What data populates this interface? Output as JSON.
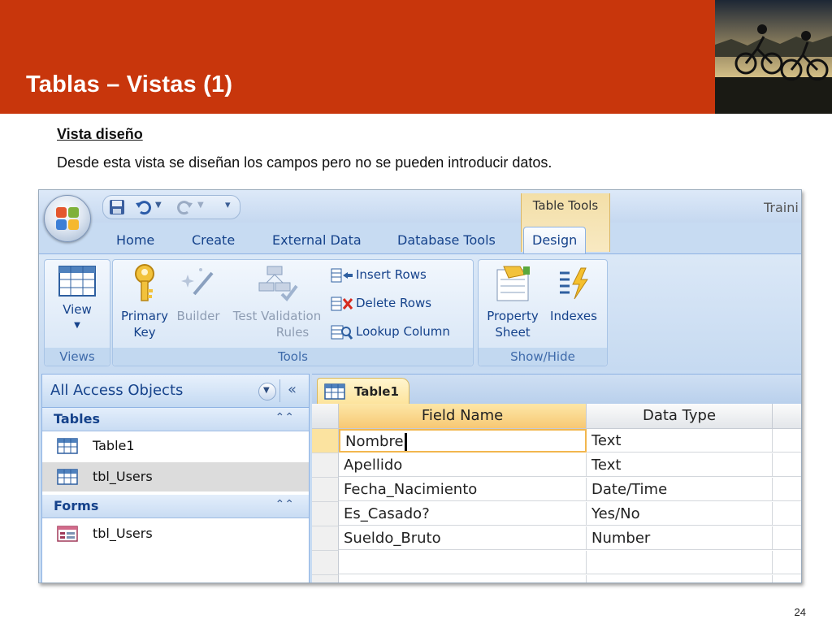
{
  "slide": {
    "title": "Tablas – Vistas (1)",
    "subtitle": "Vista diseño",
    "description": "Desde esta vista se diseñan los campos pero no se pueden introducir datos.",
    "page_number": "24",
    "accent_color": "#c8360c"
  },
  "app": {
    "title_partial": "Traini",
    "context_tab_label": "Table Tools",
    "tabs": [
      "Home",
      "Create",
      "External Data",
      "Database Tools",
      "Design"
    ],
    "active_tab": "Design"
  },
  "ribbon": {
    "views": {
      "view_label": "View",
      "group_label": "Views"
    },
    "tools": {
      "primary_key_label": "Primary Key",
      "primary_key_line1": "Primary",
      "primary_key_line2": "Key",
      "builder_label": "Builder",
      "test_label": "Test",
      "validation_rules_line1": "Validation",
      "validation_rules_line2": "Rules",
      "insert_rows_label": "Insert Rows",
      "delete_rows_label": "Delete Rows",
      "lookup_column_label": "Lookup Column",
      "group_label": "Tools"
    },
    "show_hide": {
      "property_sheet_line1": "Property",
      "property_sheet_line2": "Sheet",
      "indexes_label": "Indexes",
      "group_label": "Show/Hide"
    }
  },
  "nav_pane": {
    "title": "All Access Objects",
    "categories": [
      {
        "label": "Tables",
        "items": [
          "Table1",
          "tbl_Users"
        ]
      },
      {
        "label": "Forms",
        "items": [
          "tbl_Users"
        ]
      }
    ]
  },
  "document": {
    "tab_label": "Table1",
    "columns": [
      "Field Name",
      "Data Type"
    ],
    "rows": [
      [
        "Nombre",
        "Text"
      ],
      [
        "Apellido",
        "Text"
      ],
      [
        "Fecha_Nacimiento",
        "Date/Time"
      ],
      [
        "Es_Casado?",
        "Yes/No"
      ],
      [
        "Sueldo_Bruto",
        "Number"
      ]
    ]
  },
  "icons": [
    "office-button-icon",
    "save-icon",
    "undo-icon",
    "redo-icon",
    "customize-qat-icon",
    "view-grid-icon",
    "primary-key-icon",
    "builder-wand-icon",
    "validation-rules-icon",
    "insert-rows-icon",
    "delete-rows-icon",
    "lookup-column-icon",
    "property-sheet-icon",
    "indexes-icon",
    "table-icon",
    "form-icon"
  ]
}
